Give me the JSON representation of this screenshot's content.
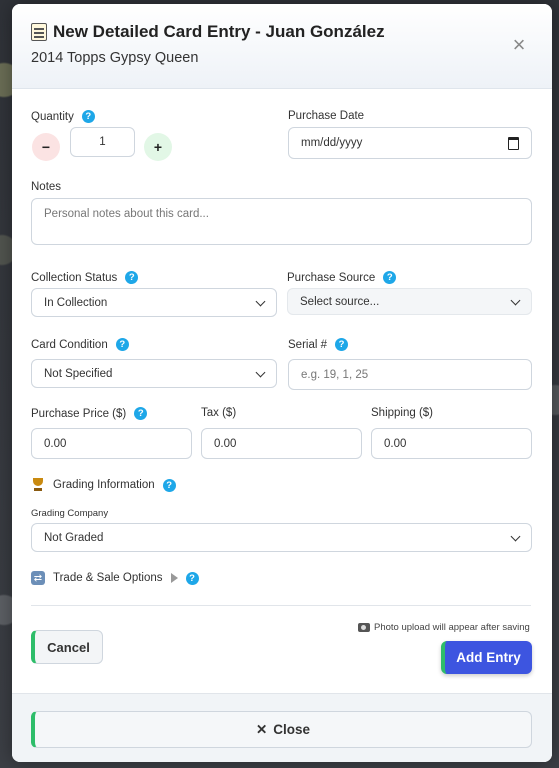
{
  "modal": {
    "title": "New Detailed Card Entry - Juan González",
    "subtitle": "2014 Topps Gypsy Queen",
    "close_symbol": "×"
  },
  "quantity": {
    "label": "Quantity",
    "value": "1",
    "minus": "−",
    "plus": "+"
  },
  "purchase_date": {
    "label": "Purchase Date",
    "placeholder": "mm/dd/yyyy"
  },
  "notes": {
    "label": "Notes",
    "placeholder": "Personal notes about this card..."
  },
  "collection_status": {
    "label": "Collection Status",
    "selected": "In Collection"
  },
  "purchase_source": {
    "label": "Purchase Source",
    "selected": "Select source..."
  },
  "card_condition": {
    "label": "Card Condition",
    "selected": "Not Specified"
  },
  "serial": {
    "label": "Serial #",
    "placeholder": "e.g. 19, 1, 25"
  },
  "purchase_price": {
    "label": "Purchase Price ($)",
    "placeholder": "0.00"
  },
  "tax": {
    "label": "Tax ($)",
    "placeholder": "0.00"
  },
  "shipping": {
    "label": "Shipping ($)",
    "placeholder": "0.00"
  },
  "grading": {
    "section_label": "Grading Information",
    "company_label": "Grading Company",
    "company_selected": "Not Graded"
  },
  "trade": {
    "label": "Trade & Sale Options"
  },
  "help_symbol": "?",
  "actions": {
    "cancel_label": "Cancel",
    "photo_note": "Photo upload will appear after saving",
    "add_label": "Add Entry"
  },
  "footer": {
    "close_label": "Close",
    "close_symbol": "✕"
  },
  "colors": {
    "accent_blue": "#3d55e0",
    "accent_green": "#2ebd6a",
    "help_blue": "#1ea7e8",
    "minus_bg": "#fbe3e3",
    "plus_bg": "#e2f7e6"
  },
  "icons": [
    "clipboard-icon",
    "close-icon",
    "help-icon",
    "calendar-icon",
    "chevron-down-icon",
    "trophy-icon",
    "swap-icon",
    "expand-triangle-icon",
    "camera-icon"
  ]
}
